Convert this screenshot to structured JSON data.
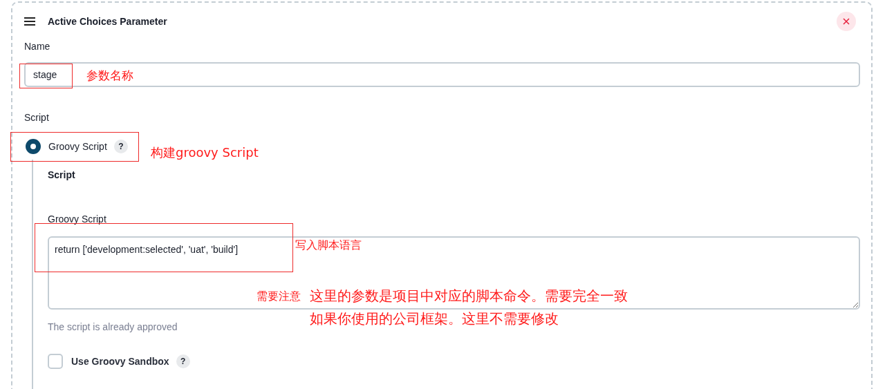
{
  "card": {
    "title": "Active Choices Parameter"
  },
  "name_field": {
    "label": "Name",
    "value": "stage"
  },
  "script_section": {
    "label": "Script",
    "options": [
      {
        "label": "Groovy Script",
        "selected": true
      }
    ]
  },
  "groovy": {
    "heading": "Script",
    "field_label": "Groovy Script",
    "value": "return ['development:selected', 'uat', 'build']",
    "hint": "The script is already approved",
    "sandbox": {
      "label": "Use Groovy Sandbox",
      "checked": false
    }
  },
  "help_mark": "?",
  "annotations": [
    {
      "text": "参数名称"
    },
    {
      "text": "构建groovy Script"
    },
    {
      "text": "写入脚本语言"
    },
    {
      "text": "需要注意"
    },
    {
      "text": "这里的参数是项目中对应的脚本命令。需要完全一致"
    },
    {
      "text": "如果你使用的公司框架。这里不需要修改"
    }
  ]
}
